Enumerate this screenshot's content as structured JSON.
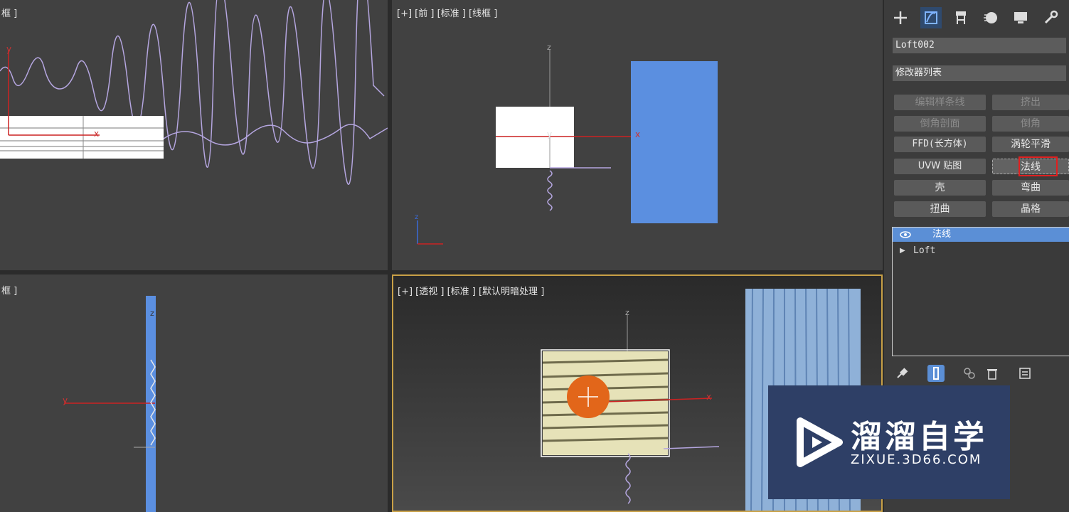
{
  "viewports": {
    "top_left": {
      "label": "框 ]"
    },
    "top_right": {
      "label": "[+] [前 ] [标准 ] [线框 ]"
    },
    "bottom_left": {
      "label": "框 ]"
    },
    "bottom_right": {
      "label": "[+] [透视 ] [标准 ] [默认明暗处理 ]"
    }
  },
  "axes": {
    "x": "x",
    "y": "y",
    "z": "z"
  },
  "panel": {
    "toolbar_icons": [
      "create-icon",
      "modify-icon",
      "hierarchy-icon",
      "motion-icon",
      "display-icon",
      "utilities-icon"
    ],
    "object_name": "Loft002",
    "modifier_list_label": "修改器列表",
    "modifier_buttons": [
      "编辑样条线",
      "挤出",
      "倒角剖面",
      "倒角",
      "FFD(长方体)",
      "涡轮平滑",
      "UVW 贴图",
      "法线",
      "壳",
      "弯曲",
      "扭曲",
      "晶格"
    ],
    "stack": {
      "active_item": "法线",
      "base_item": "Loft"
    },
    "highlight_color": "#e02020",
    "selection_color": "#5b8fd6"
  },
  "watermark": {
    "title": "溜溜自学",
    "url": "ZIXUE.3D66.COM"
  }
}
